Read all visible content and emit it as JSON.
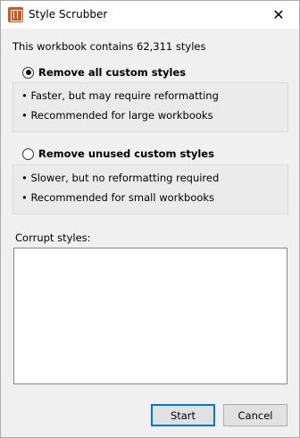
{
  "window": {
    "title": "Style Scrubber",
    "app_icon": "style-scrubber-app-icon",
    "close_icon": "close-icon",
    "close_glyph": "✕"
  },
  "summary": "This workbook contains 62,311 styles",
  "options": [
    {
      "label": "Remove all custom styles",
      "selected": true,
      "bullets": [
        "• Faster, but may require reformatting",
        "• Recommended for large workbooks"
      ]
    },
    {
      "label": "Remove unused custom styles",
      "selected": false,
      "bullets": [
        "• Slower, but no reformatting required",
        "• Recommended for small workbooks"
      ]
    }
  ],
  "corrupt": {
    "label": "Corrupt styles:",
    "value": ""
  },
  "buttons": {
    "start": "Start",
    "cancel": "Cancel"
  },
  "colors": {
    "accent": "#0078d7",
    "app_icon": "#d2551d"
  }
}
